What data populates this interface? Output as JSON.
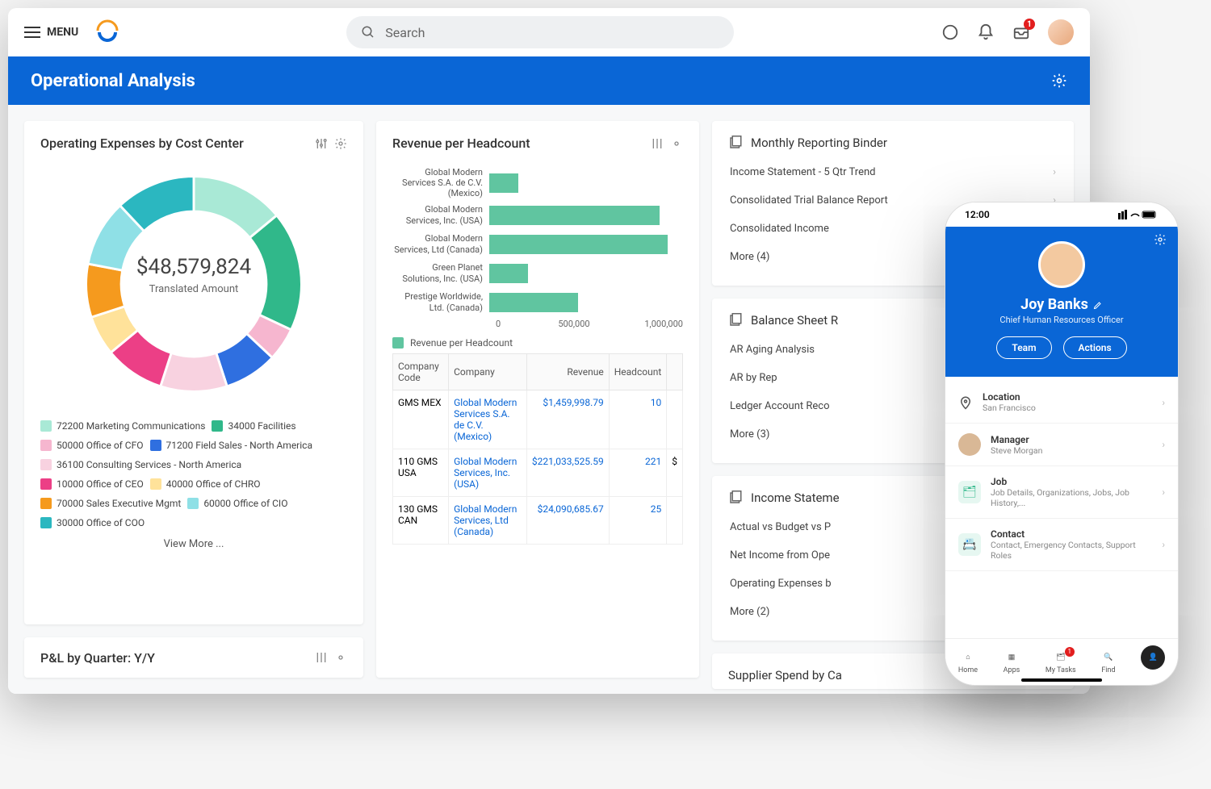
{
  "topbar": {
    "menu_label": "MENU",
    "search_placeholder": "Search",
    "inbox_badge": "1"
  },
  "page_title": "Operational Analysis",
  "donut_card": {
    "title": "Operating Expenses by Cost Center",
    "center_value": "$48,579,824",
    "center_label": "Translated Amount",
    "view_more": "View More ...",
    "legend": [
      {
        "color": "#a9e9d6",
        "label": "72200 Marketing Communications"
      },
      {
        "color": "#30b88a",
        "label": "34000 Facilities"
      },
      {
        "color": "#f6b6cf",
        "label": "50000 Office of CFO"
      },
      {
        "color": "#2f6fe0",
        "label": "71200 Field Sales - North America"
      },
      {
        "color": "#f8d2e0",
        "label": "36100 Consulting Services - North America"
      },
      {
        "color": "#ec3f86",
        "label": "10000 Office of CEO"
      },
      {
        "color": "#ffe29a",
        "label": "40000 Office of CHRO"
      },
      {
        "color": "#f59a1e",
        "label": "70000 Sales Executive Mgmt"
      },
      {
        "color": "#8fe0e6",
        "label": "60000 Office of CIO"
      },
      {
        "color": "#2bb7c0",
        "label": "30000 Office of COO"
      }
    ]
  },
  "stub_card": {
    "title": "P&L by Quarter: Y/Y"
  },
  "bar_card": {
    "title": "Revenue per Headcount",
    "legend_label": "Revenue per Headcount",
    "axis": [
      "0",
      "500,000",
      "1,000,000"
    ]
  },
  "chart_data": [
    {
      "type": "pie",
      "title": "Operating Expenses by Cost Center",
      "total_label": "Translated Amount",
      "total_value": 48579824,
      "series": [
        {
          "name": "72200 Marketing Communications",
          "value": 14,
          "color": "#a9e9d6"
        },
        {
          "name": "34000 Facilities",
          "value": 18,
          "color": "#30b88a"
        },
        {
          "name": "50000 Office of CFO",
          "value": 5,
          "color": "#f6b6cf"
        },
        {
          "name": "71200 Field Sales - North America",
          "value": 8,
          "color": "#2f6fe0"
        },
        {
          "name": "36100 Consulting Services - North America",
          "value": 10,
          "color": "#f8d2e0"
        },
        {
          "name": "10000 Office of CEO",
          "value": 9,
          "color": "#ec3f86"
        },
        {
          "name": "40000 Office of CHRO",
          "value": 6,
          "color": "#ffe29a"
        },
        {
          "name": "70000 Sales Executive Mgmt",
          "value": 8,
          "color": "#f59a1e"
        },
        {
          "name": "60000 Office of CIO",
          "value": 10,
          "color": "#8fe0e6"
        },
        {
          "name": "30000 Office of COO",
          "value": 12,
          "color": "#2bb7c0"
        }
      ]
    },
    {
      "type": "bar",
      "orientation": "horizontal",
      "title": "Revenue per Headcount",
      "xlabel": "",
      "ylabel": "",
      "xlim": [
        0,
        1000000
      ],
      "categories": [
        "Global Modern Services S.A. de C.V. (Mexico)",
        "Global Modern Services, Inc. (USA)",
        "Global Modern Services, Ltd (Canada)",
        "Green Planet Solutions, Inc. (USA)",
        "Prestige Worldwide, Ltd. (Canada)"
      ],
      "values": [
        150000,
        880000,
        920000,
        200000,
        460000
      ]
    }
  ],
  "table": {
    "headers": [
      "Company Code",
      "Company",
      "Revenue",
      "Headcount"
    ],
    "rows": [
      {
        "code": "GMS MEX",
        "company": "Global Modern Services S.A. de C.V. (Mexico)",
        "revenue": "$1,459,998.79",
        "headcount": "10"
      },
      {
        "code": "110 GMS USA",
        "company": "Global Modern Services, Inc. (USA)",
        "revenue": "$221,033,525.59",
        "headcount": "221",
        "extra": "$"
      },
      {
        "code": "130 GMS CAN",
        "company": "Global Modern Services, Ltd (Canada)",
        "revenue": "$24,090,685.67",
        "headcount": "25"
      }
    ]
  },
  "right": {
    "binder": {
      "title": "Monthly Reporting Binder",
      "items": [
        "Income Statement - 5 Qtr Trend",
        "Consolidated Trial Balance Report",
        "Consolidated Income"
      ],
      "more": "More (4)"
    },
    "balance": {
      "title": "Balance Sheet R",
      "items": [
        "AR Aging Analysis",
        "AR by Rep",
        "Ledger Account Reco"
      ],
      "more": "More (3)"
    },
    "income": {
      "title": "Income Stateme",
      "items": [
        "Actual vs Budget vs P",
        "Net Income from Ope",
        "Operating Expenses b"
      ],
      "more": "More (2)"
    },
    "supplier": {
      "title": "Supplier Spend by Ca"
    }
  },
  "phone": {
    "time": "12:00",
    "name": "Joy Banks",
    "role": "Chief Human Resources Officer",
    "btn_team": "Team",
    "btn_actions": "Actions",
    "items": [
      {
        "icon": "pin",
        "title": "Location",
        "sub": "San Francisco"
      },
      {
        "icon": "mgr",
        "title": "Manager",
        "sub": "Steve Morgan"
      },
      {
        "icon": "job",
        "title": "Job",
        "sub": "Job Details, Organizations, Jobs, Job History,..."
      },
      {
        "icon": "contact",
        "title": "Contact",
        "sub": "Contact, Emergency Contacts, Support Roles"
      }
    ],
    "nav": [
      {
        "label": "Home"
      },
      {
        "label": "Apps"
      },
      {
        "label": "My Tasks",
        "badge": "1"
      },
      {
        "label": "Find"
      },
      {
        "label": "Profile",
        "active": true
      }
    ]
  }
}
